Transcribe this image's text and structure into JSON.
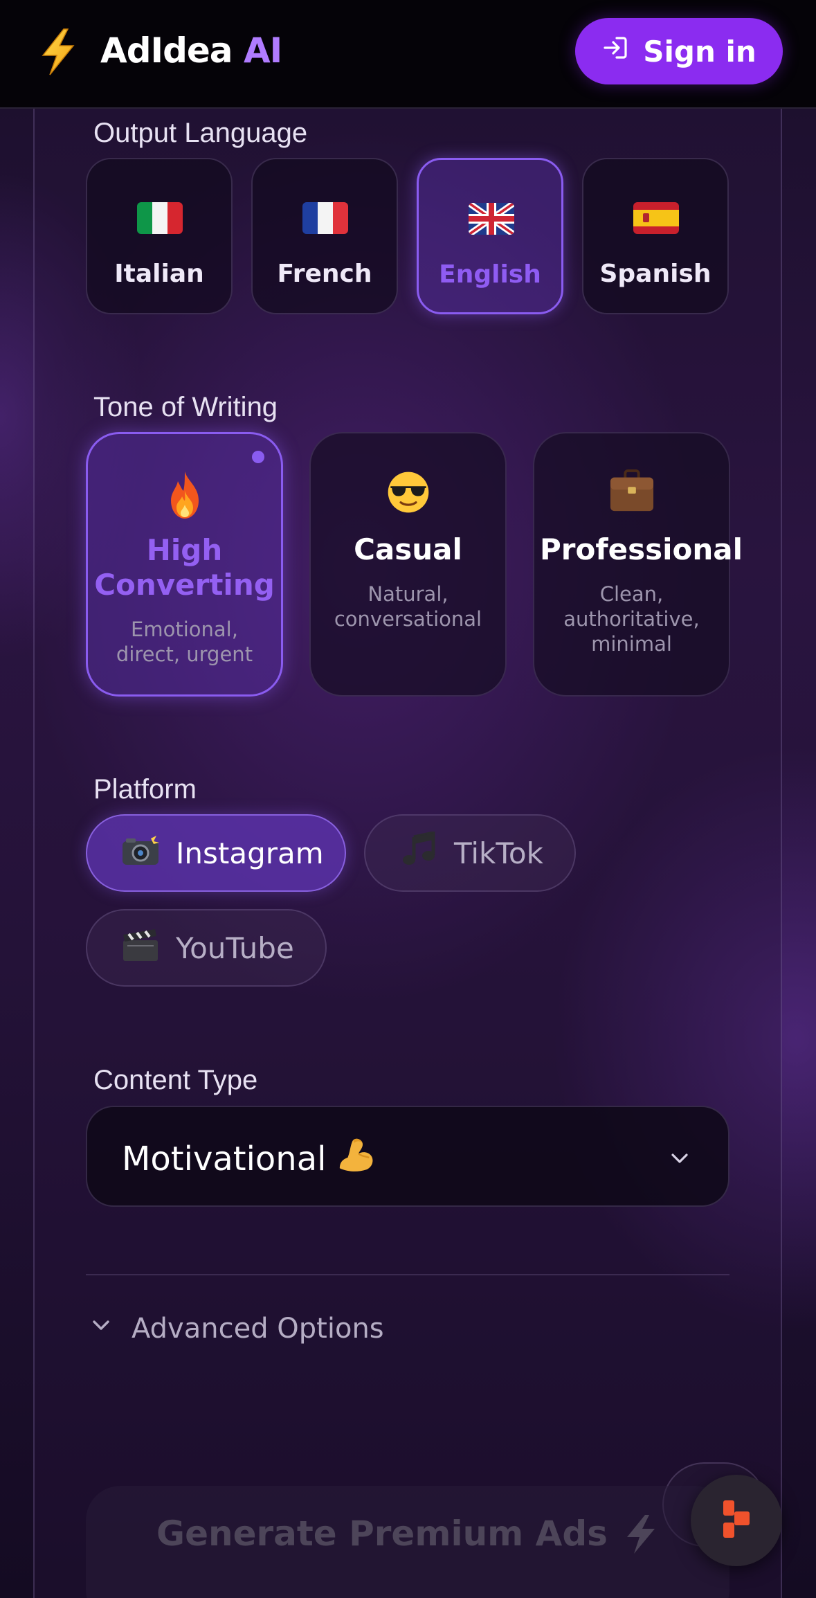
{
  "header": {
    "brand_main": "AdIdea",
    "brand_accent": "AI",
    "logo_icon": "lightning-bolt-icon",
    "signin_label": "Sign in",
    "signin_icon": "sign-in-arrow-icon",
    "accent_color": "#8b2cf0"
  },
  "language": {
    "label": "Output Language",
    "options": [
      {
        "label": "Italian",
        "icon": "italy-flag-icon",
        "selected": false
      },
      {
        "label": "French",
        "icon": "france-flag-icon",
        "selected": false
      },
      {
        "label": "English",
        "icon": "uk-flag-icon",
        "selected": true
      },
      {
        "label": "Spanish",
        "icon": "spain-flag-icon",
        "selected": false
      }
    ]
  },
  "tone": {
    "label": "Tone of Writing",
    "options": [
      {
        "title_line1": "High",
        "title_line2": "Converting",
        "desc_line1": "Emotional,",
        "desc_line2": "direct, urgent",
        "icon": "fire-icon",
        "selected": true
      },
      {
        "title_line1": "Casual",
        "desc_line1": "Natural,",
        "desc_line2": "conversational",
        "icon": "sunglasses-face-icon",
        "selected": false
      },
      {
        "title_line1": "Professional",
        "desc_line1": "Clean,",
        "desc_line2": "authoritative,",
        "desc_line3": "minimal",
        "icon": "briefcase-icon",
        "selected": false
      }
    ]
  },
  "platform": {
    "label": "Platform",
    "options": [
      {
        "label": "Instagram",
        "icon": "camera-flash-icon",
        "selected": true
      },
      {
        "label": "TikTok",
        "icon": "music-note-icon",
        "selected": false
      },
      {
        "label": "YouTube",
        "icon": "clapper-board-icon",
        "selected": false
      }
    ]
  },
  "content_type": {
    "label": "Content Type",
    "value": "Motivational",
    "value_icon": "flexed-biceps-icon"
  },
  "advanced": {
    "label": "Advanced Options"
  },
  "generate": {
    "label": "Generate Premium Ads",
    "icon": "lightning-bolt-icon"
  }
}
